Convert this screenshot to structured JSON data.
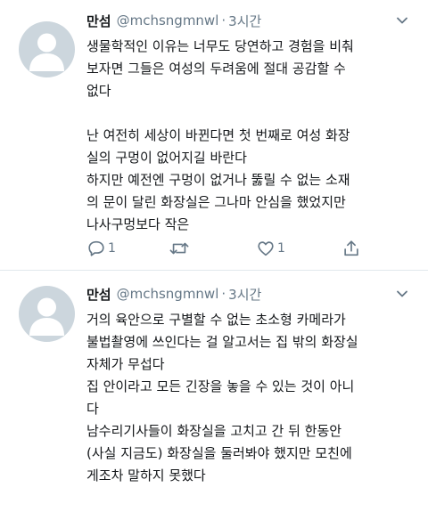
{
  "colors": {
    "text": "#14171a",
    "secondary": "#657786",
    "avatar_bg": "#ccd6dd",
    "avatar_fg": "#ffffff",
    "divider": "#e1e8ed"
  },
  "tweets": [
    {
      "name": "만섬",
      "handle": "@mchsngmnwl",
      "dot": "·",
      "time": "3시간",
      "lines": [
        "생물학적인 이유는 너무도 당연하고 경험을 비춰",
        "보자면 그들은 여성의 두려움에 절대 공감할 수",
        "없다",
        "",
        "난 여전히 세상이 바뀐다면 첫 번째로 여성 화장",
        "실의 구멍이 없어지길 바란다",
        "하지만 예전엔 구멍이 없거나 뚫릴 수 없는 소재",
        "의 문이 달린 화장실은 그나마 안심을 했었지만",
        "나사구멍보다 작은"
      ],
      "actions": {
        "reply_count": "1",
        "retweet_count": "",
        "like_count": "1"
      },
      "icons": [
        "avatar-icon",
        "chevron-down-icon",
        "reply-icon",
        "retweet-icon",
        "like-icon",
        "share-icon"
      ]
    },
    {
      "name": "만섬",
      "handle": "@mchsngmnwl",
      "dot": "·",
      "time": "3시간",
      "lines": [
        "거의 육안으로 구별할 수 없는 초소형 카메라가",
        "불법촬영에 쓰인다는 걸 알고서는 집 밖의 화장실",
        "자체가 무섭다",
        "집 안이라고 모든 긴장을 놓을 수 있는 것이 아니",
        "다",
        "남수리기사들이 화장실을 고치고 간 뒤 한동안",
        "(사실 지금도) 화장실을 둘러봐야 했지만 모친에",
        "게조차 말하지 못했다"
      ],
      "icons": [
        "avatar-icon",
        "chevron-down-icon"
      ]
    }
  ]
}
